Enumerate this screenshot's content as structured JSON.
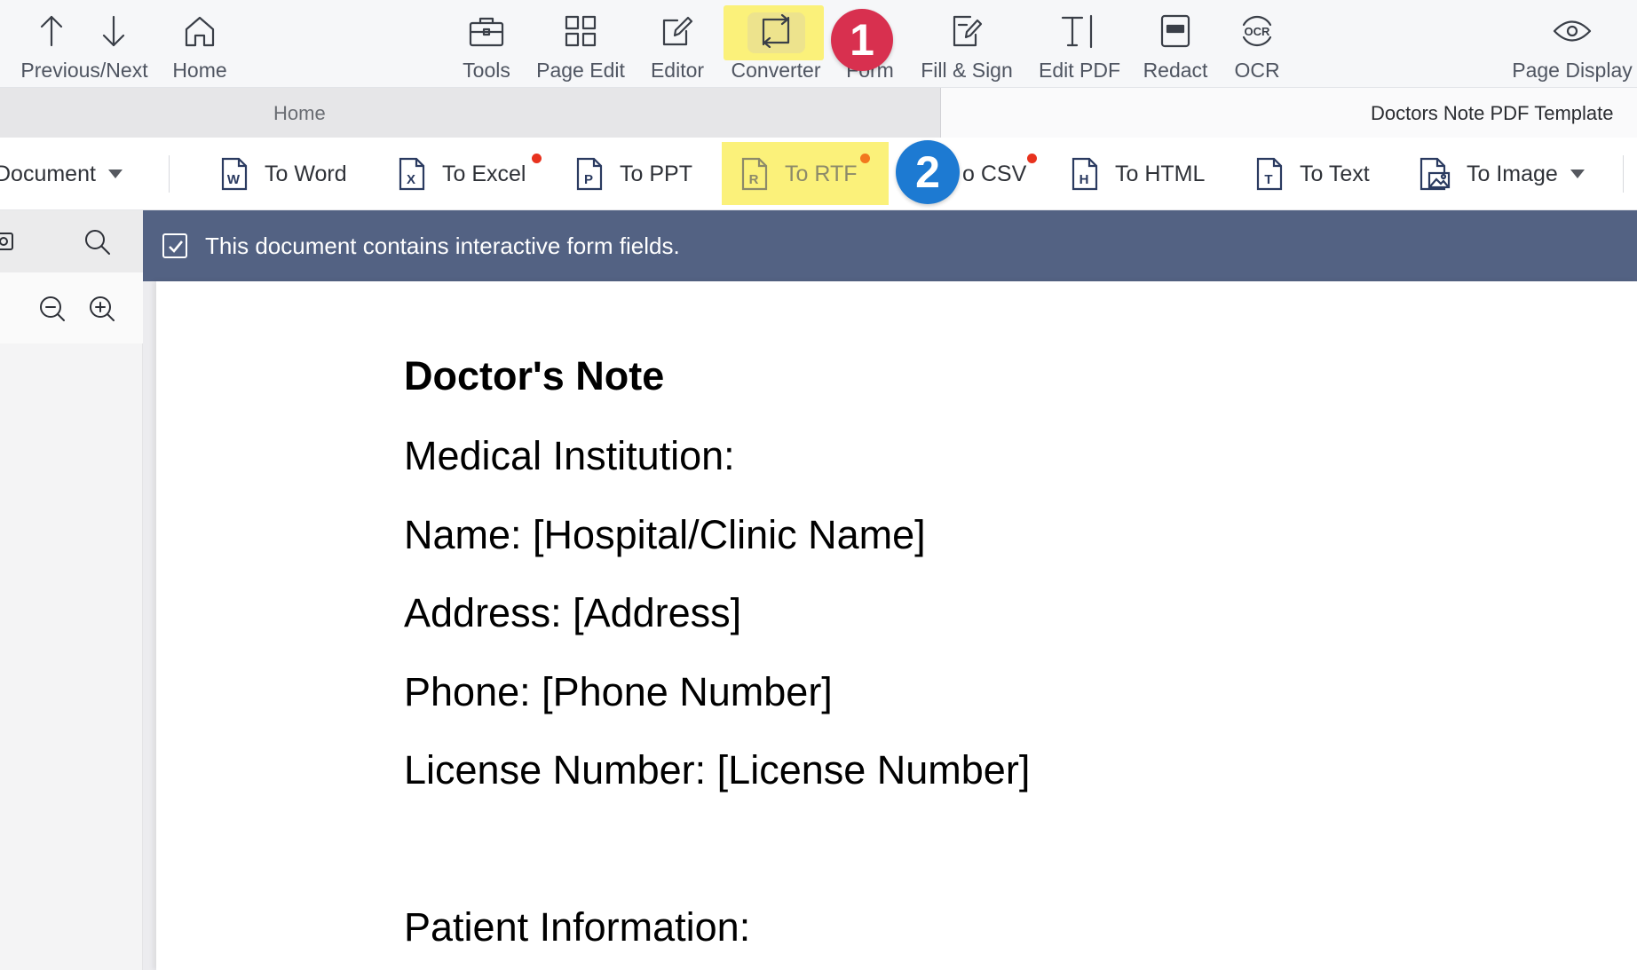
{
  "toolbar": {
    "prev_next": "Previous/Next",
    "home": "Home",
    "tools": "Tools",
    "page_edit": "Page Edit",
    "editor": "Editor",
    "converter": "Converter",
    "form": "Form",
    "fill_sign": "Fill & Sign",
    "edit_pdf": "Edit PDF",
    "redact": "Redact",
    "ocr": "OCR",
    "ocr_icon_text": "OCR",
    "page_display": "Page Display"
  },
  "badges": {
    "step1": "1",
    "step2": "2"
  },
  "tabs": {
    "home": "Home",
    "document": "Doctors Note PDF Template"
  },
  "ribbon": {
    "create_document": "Document",
    "to_word": "To Word",
    "to_excel": "To Excel",
    "to_ppt": "To PPT",
    "to_rtf": "To RTF",
    "to_csv": "o CSV",
    "to_html": "To HTML",
    "to_text": "To Text",
    "to_image": "To Image",
    "icons": {
      "word": "W",
      "excel": "X",
      "ppt": "P",
      "rtf": "R",
      "html": "H",
      "text": "T"
    }
  },
  "notice": {
    "text": "This document contains interactive form fields."
  },
  "document": {
    "title": "Doctor's Note",
    "lines": [
      "Medical Institution:",
      "Name: [Hospital/Clinic Name]",
      "Address: [Address]",
      "Phone: [Phone Number]",
      "License Number: [License Number]",
      "",
      "Patient Information:"
    ]
  },
  "colors": {
    "highlight": "#fbf17a",
    "badge_red": "#d8304f",
    "badge_blue": "#1d7ad2",
    "notice_bg": "#536283",
    "new_dot_red": "#e8321e",
    "new_dot_orange": "#f2781e"
  }
}
